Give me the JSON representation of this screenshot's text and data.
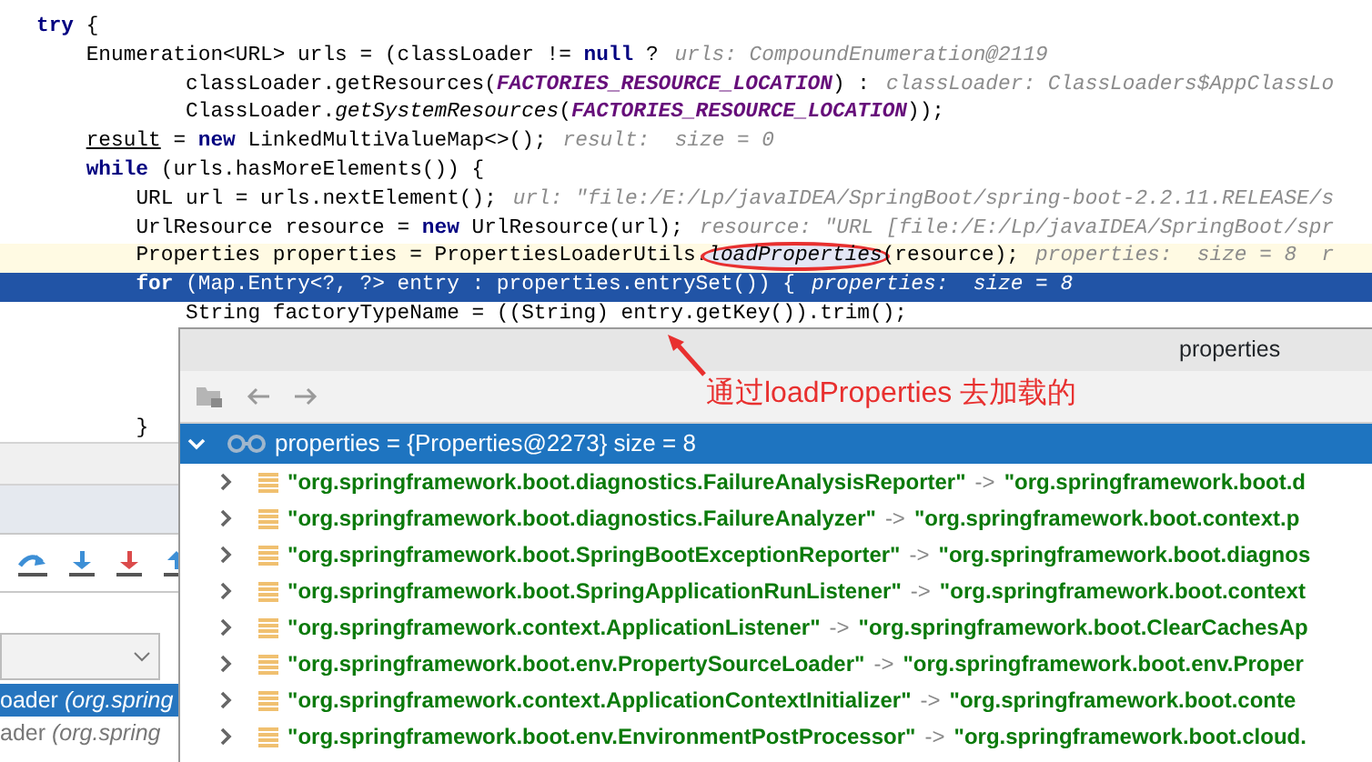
{
  "code_lines": [
    {
      "kind": "normal",
      "segments": [
        {
          "text": "try",
          "kind": "keyword"
        },
        {
          "text": " {",
          "kind": "plain"
        }
      ]
    },
    {
      "kind": "normal",
      "segments": [
        {
          "text": "    Enumeration<URL> urls = (classLoader != ",
          "kind": "plain"
        },
        {
          "text": "null",
          "kind": "keyword"
        },
        {
          "text": " ?",
          "kind": "plain"
        },
        {
          "text": "urls: CompoundEnumeration@2119",
          "kind": "hint"
        }
      ]
    },
    {
      "kind": "normal",
      "segments": [
        {
          "text": "            classLoader.getResources(",
          "kind": "plain"
        },
        {
          "text": "FACTORIES_RESOURCE_LOCATION",
          "kind": "constant"
        },
        {
          "text": ") :",
          "kind": "plain"
        },
        {
          "text": "classLoader: ClassLoaders$AppClassLo",
          "kind": "hint"
        }
      ]
    },
    {
      "kind": "normal",
      "segments": [
        {
          "text": "            ClassLoader.",
          "kind": "plain"
        },
        {
          "text": "getSystemResources",
          "kind": "static"
        },
        {
          "text": "(",
          "kind": "plain"
        },
        {
          "text": "FACTORIES_RESOURCE_LOCATION",
          "kind": "constant"
        },
        {
          "text": "));",
          "kind": "plain"
        }
      ]
    },
    {
      "kind": "normal",
      "segments": [
        {
          "text": "    result",
          "kind": "field"
        },
        {
          "text": " = ",
          "kind": "plain"
        },
        {
          "text": "new",
          "kind": "keyword"
        },
        {
          "text": " LinkedMultiValueMap<>();",
          "kind": "plain"
        },
        {
          "text": "result:  size = 0",
          "kind": "hint"
        }
      ]
    },
    {
      "kind": "normal",
      "segments": [
        {
          "text": "    while",
          "kind": "keyword"
        },
        {
          "text": " (urls.hasMoreElements()) {",
          "kind": "plain"
        }
      ]
    },
    {
      "kind": "normal",
      "segments": [
        {
          "text": "        URL url = urls.nextElement();",
          "kind": "plain"
        },
        {
          "text": "url: \"file:/E:/Lp/javaIDEA/SpringBoot/spring-boot-2.2.11.RELEASE/s",
          "kind": "hint"
        }
      ]
    },
    {
      "kind": "normal",
      "segments": [
        {
          "text": "        UrlResource resource = ",
          "kind": "plain"
        },
        {
          "text": "new",
          "kind": "keyword"
        },
        {
          "text": " UrlResource(url);",
          "kind": "plain"
        },
        {
          "text": "resource: \"URL [file:/E:/Lp/javaIDEA/SpringBoot/spr",
          "kind": "hint"
        }
      ]
    },
    {
      "kind": "caret",
      "segments": [
        {
          "text": "        Properties properties = PropertiesLoaderUtils.",
          "kind": "plain"
        },
        {
          "text": "loadProperties",
          "kind": "circled"
        },
        {
          "text": "(resource);",
          "kind": "plain"
        },
        {
          "text": "properties:  size = 8  r",
          "kind": "hint"
        }
      ]
    },
    {
      "kind": "execution",
      "segments": [
        {
          "text": "        for",
          "kind": "keyword"
        },
        {
          "text": " (Map.Entry<?, ?> entry : properties.entrySet()) {",
          "kind": "plain"
        },
        {
          "text": "properties:  size = 8",
          "kind": "hint"
        }
      ]
    },
    {
      "kind": "normal",
      "segments": [
        {
          "text": "            String factoryTypeName = ((String) entry.getKey()).trim();",
          "kind": "plain"
        }
      ]
    },
    {
      "kind": "normal",
      "segments": [
        {
          "text": "        }",
          "kind": "plain"
        }
      ]
    }
  ],
  "annotation": {
    "text": "通过loadProperties 去加载的"
  },
  "popup": {
    "title": "properties",
    "root": {
      "text": "properties = {Properties@2273}  size = 8",
      "expanded": true,
      "selected": true
    },
    "entries": [
      {
        "key": "\"org.springframework.boot.diagnostics.FailureAnalysisReporter\"",
        "arrow": "->",
        "value": "\"org.springframework.boot.d",
        "expanded": false
      },
      {
        "key": "\"org.springframework.boot.diagnostics.FailureAnalyzer\"",
        "arrow": "->",
        "value": "\"org.springframework.boot.context.p",
        "expanded": false
      },
      {
        "key": "\"org.springframework.boot.SpringBootExceptionReporter\"",
        "arrow": "->",
        "value": "\"org.springframework.boot.diagnos",
        "expanded": false
      },
      {
        "key": "\"org.springframework.boot.SpringApplicationRunListener\"",
        "arrow": "->",
        "value": "\"org.springframework.boot.context",
        "expanded": false
      },
      {
        "key": "\"org.springframework.context.ApplicationListener\"",
        "arrow": "->",
        "value": "\"org.springframework.boot.ClearCachesAp",
        "expanded": false
      },
      {
        "key": "\"org.springframework.boot.env.PropertySourceLoader\"",
        "arrow": "->",
        "value": "\"org.springframework.boot.env.Proper",
        "expanded": false
      },
      {
        "key": "\"org.springframework.context.ApplicationContextInitializer\"",
        "arrow": "->",
        "value": "\"org.springframework.boot.conte",
        "expanded": false
      },
      {
        "key": "\"org.springframework.boot.env.EnvironmentPostProcessor\"",
        "arrow": "->",
        "value": "\"org.springframework.boot.cloud.",
        "expanded": false
      }
    ]
  },
  "frames": [
    {
      "method": "oader",
      "location": "(org.spring",
      "selected": true
    },
    {
      "method": "ader",
      "location": "(org.spring",
      "selected": false
    }
  ]
}
